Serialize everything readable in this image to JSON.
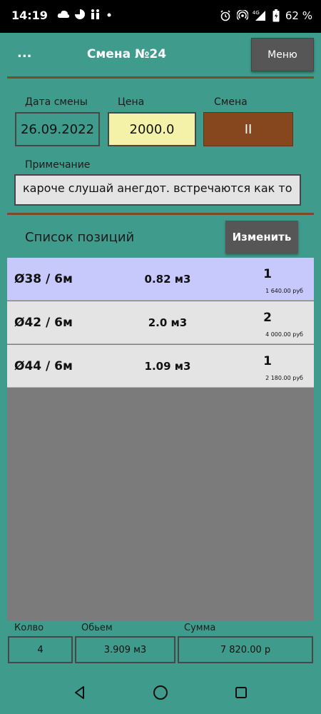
{
  "status_bar": {
    "time": "14:19",
    "battery_percent": "62 %",
    "network_label": "4G",
    "icons_left": [
      "cloud-icon",
      "pie-icon",
      "figures-icon",
      "dot-icon"
    ],
    "icons_right": [
      "alarm-icon",
      "hotspot-icon",
      "signal-icon",
      "battery-icon"
    ]
  },
  "header": {
    "menu_dots": "...",
    "title": "Смена №24",
    "menu_button": "Меню"
  },
  "form": {
    "date_label": "Дата смены",
    "date_value": "26.09.2022",
    "price_label": "Цена",
    "price_value": "2000.0",
    "shift_label": "Смена",
    "shift_button": "II",
    "note_label": "Примечание",
    "note_value": "кароче слушай анегдот. встречаются как то"
  },
  "list": {
    "title": "Список позиций",
    "edit_button": "Изменить",
    "rows": [
      {
        "name": "Ø38 / 6м",
        "volume": "0.82 м3",
        "qty": "1",
        "sum": "1 640.00 руб",
        "selected": true
      },
      {
        "name": "Ø42 / 6м",
        "volume": "2.0 м3",
        "qty": "2",
        "sum": "4 000.00 руб",
        "selected": false
      },
      {
        "name": "Ø44 / 6м",
        "volume": "1.09 м3",
        "qty": "1",
        "sum": "2 180.00 руб",
        "selected": false
      }
    ]
  },
  "totals": {
    "count_label": "Колво",
    "count_value": "4",
    "volume_label": "Обьем",
    "volume_value": "3.909 м3",
    "sum_label": "Сумма",
    "sum_value": "7 820.00 р"
  },
  "colors": {
    "background": "#3f9b8c",
    "divider": "#7b4a2a",
    "shift_button": "#86471f",
    "price_field": "#f3f2a8",
    "selected_row": "#c7c8fc",
    "dark_button": "#565656"
  }
}
